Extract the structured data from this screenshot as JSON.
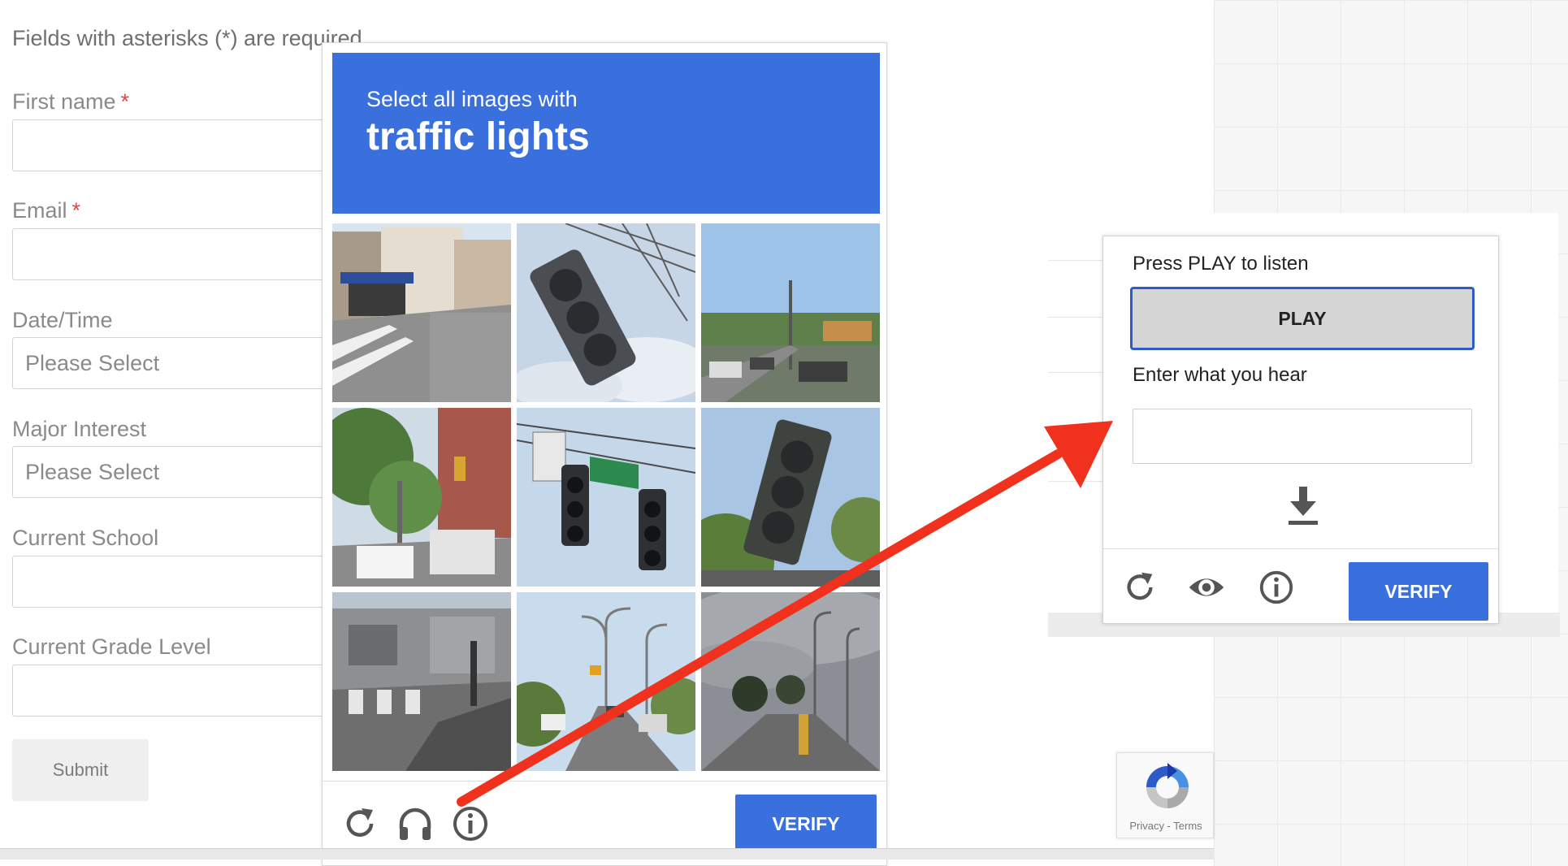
{
  "form": {
    "note": "Fields with asterisks (*) are required",
    "required_mark": "*",
    "fields": [
      {
        "label": "First name",
        "required": true,
        "value": ""
      },
      {
        "label": "Email",
        "required": true,
        "value": ""
      },
      {
        "label": "Date/Time",
        "required": false,
        "value": "Please Select"
      },
      {
        "label": "Major Interest",
        "required": false,
        "value": "Please Select"
      },
      {
        "label": "Current School",
        "required": false,
        "value": ""
      },
      {
        "label": "Current Grade Level",
        "required": false,
        "value": ""
      }
    ],
    "submit_label": "Submit"
  },
  "captcha": {
    "instruction": "Select all images with",
    "target": "traffic lights",
    "header_color": "#3a6fde",
    "tiles": [
      "street-corner-image",
      "traffic-light-closeup-image",
      "road-with-cars-image",
      "city-street-trees-image",
      "hanging-traffic-lights-image",
      "traffic-light-tree-image",
      "crosswalk-image",
      "street-lamps-road-image",
      "cloudy-road-image"
    ],
    "footer_icons": [
      "reload-icon",
      "headphones-icon",
      "info-icon"
    ],
    "verify_label": "VERIFY"
  },
  "audio_challenge": {
    "listen_label": "Press PLAY to listen",
    "play_label": "PLAY",
    "enter_label": "Enter what you hear",
    "input_value": "",
    "footer_icons": [
      "reload-icon",
      "eye-icon",
      "info-icon"
    ],
    "verify_label": "VERIFY"
  },
  "badge": {
    "text": "Privacy - Terms"
  },
  "colors": {
    "accent": "#3a6fde",
    "arrow": "#f0311e"
  }
}
